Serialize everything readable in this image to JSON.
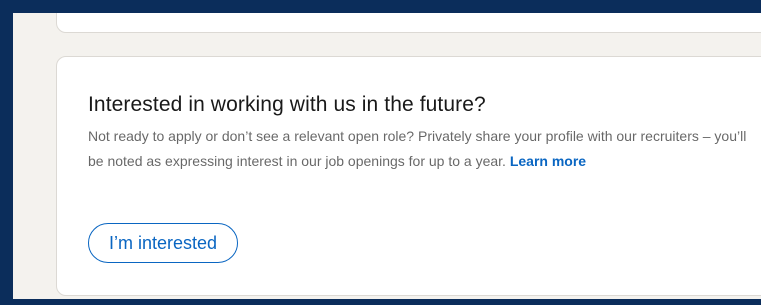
{
  "interest_card": {
    "heading": "Interested in working with us in the future?",
    "description": "Not ready to apply or don’t see a relevant open role? Privately share your profile with our recruiters – you’ll be noted as expressing interest in our job openings for up to a year.",
    "learn_more_link": "Learn more",
    "interested_button": "I’m interested"
  },
  "colors": {
    "page_background": "#f4f2ee",
    "frame_border": "#0b2d5b",
    "accent_blue": "#0a66c2"
  }
}
